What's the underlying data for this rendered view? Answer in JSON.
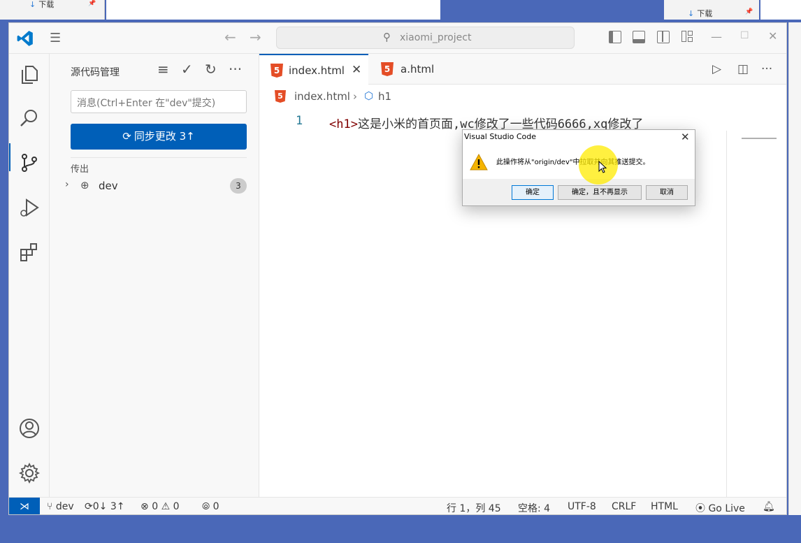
{
  "background": {
    "left_window_item": "下载",
    "right_window_item": "下载"
  },
  "titlebar": {
    "search_text": "xiaomi_project"
  },
  "sidebar": {
    "title": "源代码管理",
    "message_placeholder": "消息(Ctrl+Enter 在\"dev\"提交)",
    "sync_button": "同步更改 3↑",
    "outgoing_header": "传出",
    "branch_item": "dev",
    "branch_badge": "3"
  },
  "editor": {
    "tabs": [
      {
        "label": "index.html",
        "active": true
      },
      {
        "label": "a.html",
        "active": false
      }
    ],
    "breadcrumb": {
      "file": "index.html",
      "symbol": "h1"
    },
    "line_number": "1",
    "code": {
      "open_bracket": "<",
      "tag": "h1",
      "close_bracket": ">",
      "text": "这是小米的首页面,wc修改了一些代码6666,xq修改了"
    }
  },
  "dialog": {
    "title": "Visual Studio Code",
    "message": "此操作将从\"origin/dev\"中拉取并向其推送提交。",
    "buttons": {
      "ok": "确定",
      "ok_dont_show": "确定，且不再显示",
      "cancel": "取消"
    }
  },
  "statusbar": {
    "branch": "dev",
    "sync": "0↓ 3↑",
    "errors": "0",
    "warnings": "0",
    "ports": "0",
    "position": "行 1，列 45",
    "spaces": "空格: 4",
    "encoding": "UTF-8",
    "eol": "CRLF",
    "language": "HTML",
    "golive": "Go Live"
  },
  "colors": {
    "accent": "#005fb8",
    "html_icon": "#e44d26",
    "desktop": "#4a68b8"
  }
}
